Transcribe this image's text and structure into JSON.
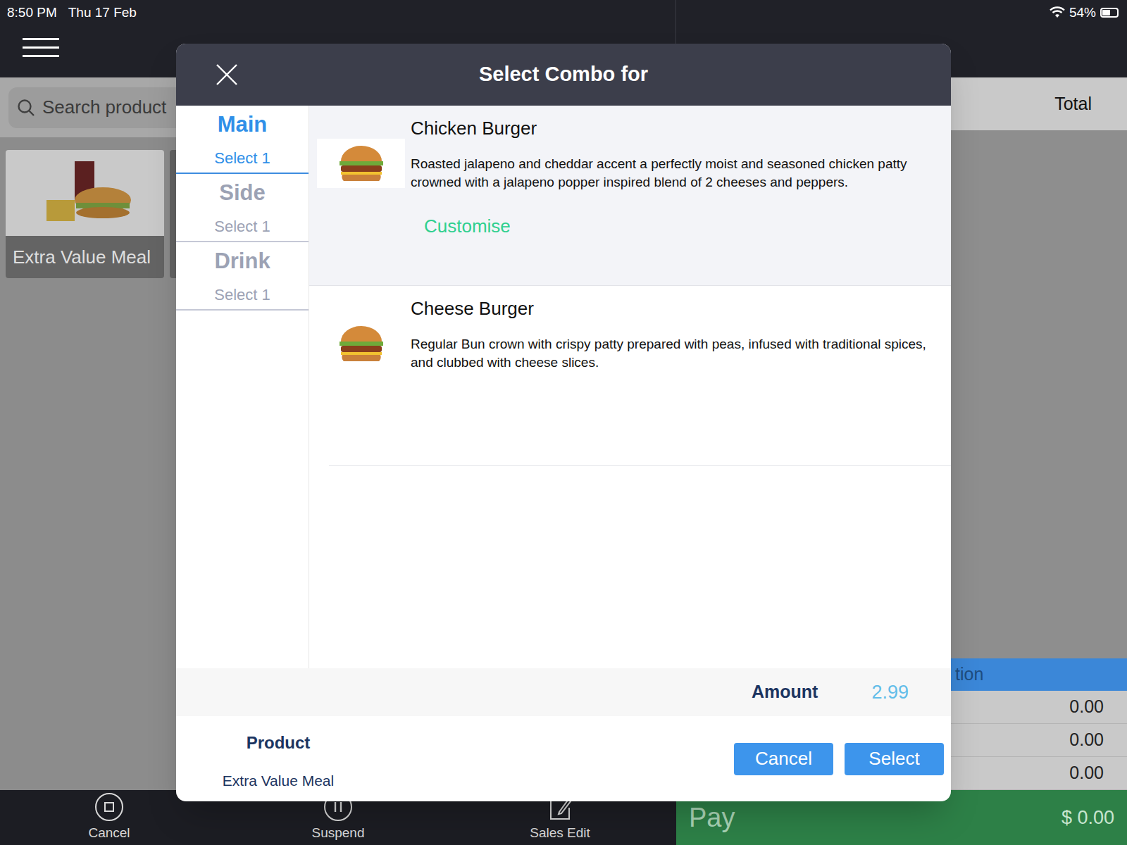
{
  "status_bar": {
    "time": "8:50 PM",
    "date": "Thu 17 Feb",
    "battery": "54%",
    "battery_level": 0.54
  },
  "search": {
    "placeholder": "Search product"
  },
  "products": [
    {
      "label": "Extra Value Meal"
    }
  ],
  "order_panel": {
    "total_header": "Total",
    "summary_label": "tion",
    "values": [
      "0.00",
      "0.00",
      "0.00"
    ]
  },
  "toolbar": [
    {
      "label": "Cancel"
    },
    {
      "label": "Suspend"
    },
    {
      "label": "Sales Edit"
    }
  ],
  "pay": {
    "label": "Pay",
    "amount": "$ 0.00"
  },
  "dialog": {
    "title": "Select Combo for",
    "categories": [
      {
        "name": "Main",
        "hint": "Select 1",
        "selected": true
      },
      {
        "name": "Side",
        "hint": "Select 1",
        "selected": false
      },
      {
        "name": "Drink",
        "hint": "Select 1",
        "selected": false
      }
    ],
    "items": [
      {
        "name": "Chicken Burger",
        "description": "Roasted jalapeno and cheddar accent a perfectly moist and seasoned chicken patty crowned with a jalapeno popper inspired blend of 2 cheeses and peppers.",
        "selected": true,
        "action": "Customise"
      },
      {
        "name": "Cheese Burger",
        "description": "Regular Bun crown with crispy patty prepared with peas, infused with traditional spices, and clubbed with cheese slices.",
        "selected": false
      }
    ],
    "amount_label": "Amount",
    "amount": "2.99",
    "product_label": "Product",
    "product": "Extra Value Meal",
    "buttons": [
      {
        "label": "Cancel"
      },
      {
        "label": "Select"
      }
    ]
  }
}
